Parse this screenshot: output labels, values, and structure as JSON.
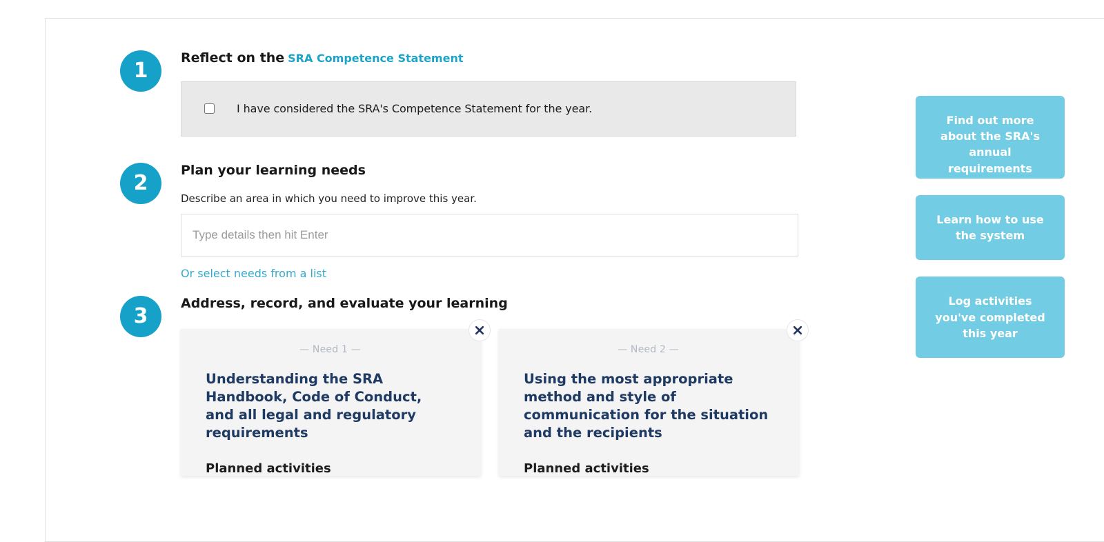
{
  "steps": [
    {
      "number": "1",
      "heading": "Reflect on the",
      "link_label": "SRA Competence Statement",
      "checkbox": {
        "checked": false,
        "label": "I have considered the SRA's Competence Statement for the year."
      }
    },
    {
      "number": "2",
      "heading": "Plan your learning needs",
      "hint": "Describe an area in which you need to improve this year.",
      "input": {
        "value": "",
        "placeholder": "Type details then hit Enter"
      },
      "sub_link": "Or select needs from a list"
    },
    {
      "number": "3",
      "heading": "Address, record, and evaluate your learning"
    }
  ],
  "need_cards": [
    {
      "tag": "— Need 1 —",
      "title": "Understanding the SRA Handbook, Code of Conduct, and all legal and regulatory requirements",
      "section_title": "Planned activities",
      "close_icon": "close-icon"
    },
    {
      "tag": "— Need 2 —",
      "title": "Using the most appropriate method and style of communication for the situation and the recipients",
      "section_title": "Planned activities",
      "close_icon": "close-icon"
    }
  ],
  "side_buttons": [
    {
      "label": "Find out more about the SRA's annual requirements"
    },
    {
      "label": "Learn how to use the system"
    },
    {
      "label": "Log activities you've completed this year"
    }
  ],
  "colors": {
    "step_badge": "#16a2c8",
    "accent_link": "#1ca3c8",
    "sub_link": "#35a9cc",
    "side_button": "#72cce3",
    "card_title": "#1f3a63",
    "need_tag": "#b3b9c4",
    "card_bg": "#f4f4f4",
    "checkbox_panel_bg": "#e9e9e9"
  }
}
